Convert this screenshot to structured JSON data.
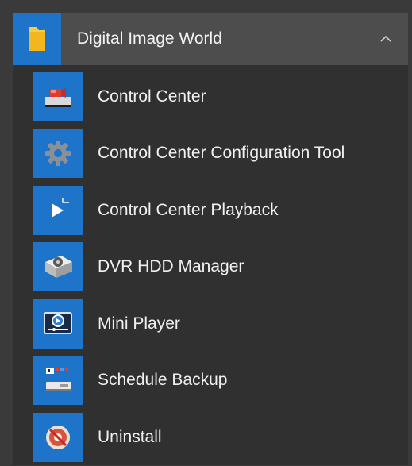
{
  "group": {
    "title": "Digital Image World",
    "icon": "folder-icon",
    "expanded": true
  },
  "items": [
    {
      "label": "Control Center",
      "icon": "camera-monitor-icon"
    },
    {
      "label": "Control Center Configuration Tool",
      "icon": "gear-icon"
    },
    {
      "label": "Control Center Playback",
      "icon": "play-icon"
    },
    {
      "label": "DVR HDD Manager",
      "icon": "hard-drive-icon"
    },
    {
      "label": "Mini Player",
      "icon": "media-player-icon"
    },
    {
      "label": "Schedule Backup",
      "icon": "backup-icon"
    },
    {
      "label": "Uninstall",
      "icon": "uninstall-icon"
    }
  ],
  "colors": {
    "tile": "#1e74c9",
    "header_bg": "#4d4d4d",
    "menu_bg": "#303030",
    "text": "#f0f0f0"
  }
}
